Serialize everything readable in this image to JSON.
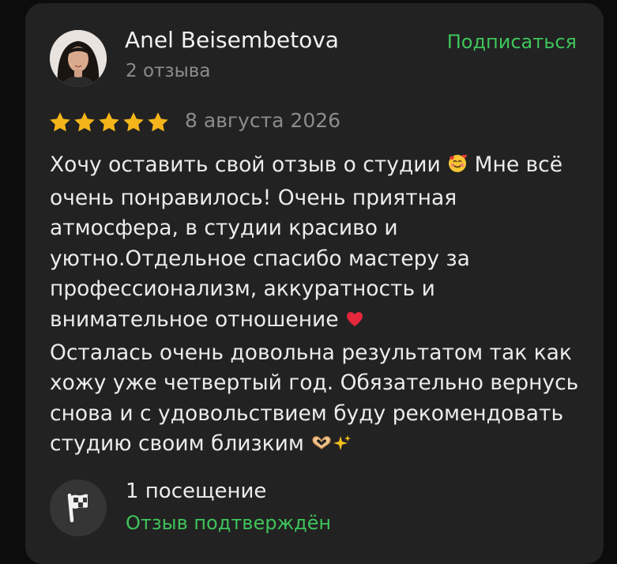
{
  "author": {
    "name": "Anel Beisembetova",
    "reviews_count": "2 отзыва"
  },
  "subscribe_label": "Подписаться",
  "review": {
    "rating": 5,
    "max_rating": 5,
    "date": "8 августа 2026",
    "paragraph_1": "Хочу оставить свой отзыв о студии",
    "paragraph_1_b": "Мне всё очень понравилось! Очень приятная атмосфера, в студии красиво и уютно.Отдельное спасибо мастеру за профессионализм, аккуратность и внимательное отношение",
    "paragraph_2": "Осталась очень довольна результатом так как хожу уже четвертый год. Обязательно вернусь снова и с удовольствием буду рекомендовать студию своим близким",
    "emojis": [
      "smiling-face-with-hearts",
      "red-heart",
      "heart-hands",
      "sparkles"
    ]
  },
  "footer": {
    "visits": "1 посещение",
    "verified": "Отзыв подтверждён"
  },
  "colors": {
    "accent_green": "#3ec45b",
    "star_gold": "#f5b51a",
    "card_bg": "#222222",
    "muted_text": "#8c8c8c"
  }
}
